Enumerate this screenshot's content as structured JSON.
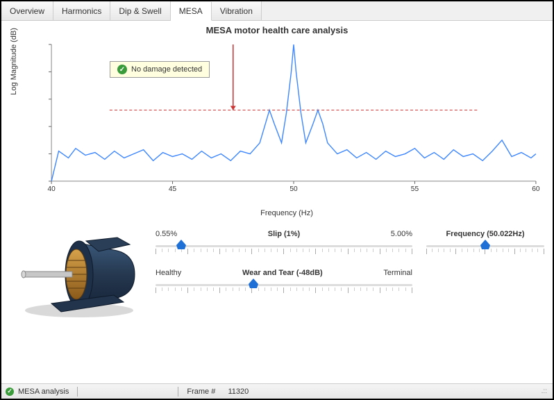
{
  "tabs": {
    "overview": "Overview",
    "harmonics": "Harmonics",
    "dipswell": "Dip & Swell",
    "mesa": "MESA",
    "vibration": "Vibration",
    "active": "mesa"
  },
  "chart": {
    "title": "MESA motor health care analysis",
    "xlabel": "Frequency (Hz)",
    "ylabel": "Log Magnitude (dB)",
    "legend_text": "No damage detected"
  },
  "chart_data": {
    "type": "line",
    "title": "MESA motor health care analysis",
    "xlabel": "Frequency (Hz)",
    "ylabel": "Log Magnitude (dB)",
    "xlim": [
      40,
      60
    ],
    "ylim": [
      -100,
      0
    ],
    "xticks": [
      40,
      45,
      50,
      55,
      60
    ],
    "yticks": [
      -100,
      -80,
      -60,
      -40,
      -20,
      0
    ],
    "series": [
      {
        "name": "spectrum",
        "color": "#3f87ff",
        "x": [
          40,
          40.3,
          40.7,
          41,
          41.4,
          41.8,
          42.2,
          42.6,
          43,
          43.4,
          43.8,
          44.2,
          44.6,
          45,
          45.4,
          45.8,
          46.2,
          46.6,
          47,
          47.4,
          47.8,
          48.2,
          48.6,
          48.8,
          49,
          49.2,
          49.5,
          49.7,
          49.9,
          50,
          50.1,
          50.3,
          50.5,
          50.8,
          51,
          51.2,
          51.4,
          51.8,
          52.2,
          52.6,
          53,
          53.4,
          53.8,
          54.2,
          54.6,
          55,
          55.4,
          55.8,
          56.2,
          56.6,
          57,
          57.4,
          57.8,
          58.2,
          58.6,
          59,
          59.4,
          59.8,
          60
        ],
        "y": [
          -100,
          -78,
          -83,
          -76,
          -81,
          -79,
          -84,
          -78,
          -83,
          -80,
          -77,
          -85,
          -79,
          -82,
          -80,
          -84,
          -78,
          -83,
          -80,
          -85,
          -78,
          -80,
          -72,
          -60,
          -48,
          -58,
          -72,
          -50,
          -20,
          0,
          -20,
          -50,
          -72,
          -58,
          -48,
          -58,
          -72,
          -80,
          -77,
          -83,
          -79,
          -84,
          -78,
          -82,
          -80,
          -76,
          -83,
          -79,
          -84,
          -77,
          -82,
          -80,
          -85,
          -78,
          -70,
          -82,
          -79,
          -83,
          -80
        ]
      }
    ],
    "annotations": [
      {
        "type": "hline",
        "y": -48,
        "x0": 42.4,
        "x1": 57.6,
        "style": "dashed",
        "color": "#cc3333"
      },
      {
        "type": "vline",
        "x": 47.5,
        "y0": -48,
        "y1": 0,
        "color": "#cc3333"
      },
      {
        "type": "label",
        "text": "No damage detected",
        "x": 44,
        "y": -15
      }
    ]
  },
  "sliders": {
    "slip": {
      "min_label": "0.55%",
      "max_label": "5.00%",
      "title": "Slip (1%)",
      "pos": 0.1
    },
    "freq": {
      "title": "Frequency (50.022Hz)",
      "pos": 0.5
    },
    "wear": {
      "min_label": "Healthy",
      "max_label": "Terminal",
      "title": "Wear and Tear (-48dB)",
      "pos": 0.38
    }
  },
  "status": {
    "label": "MESA analysis",
    "frame_label": "Frame #",
    "frame_value": "11320"
  }
}
